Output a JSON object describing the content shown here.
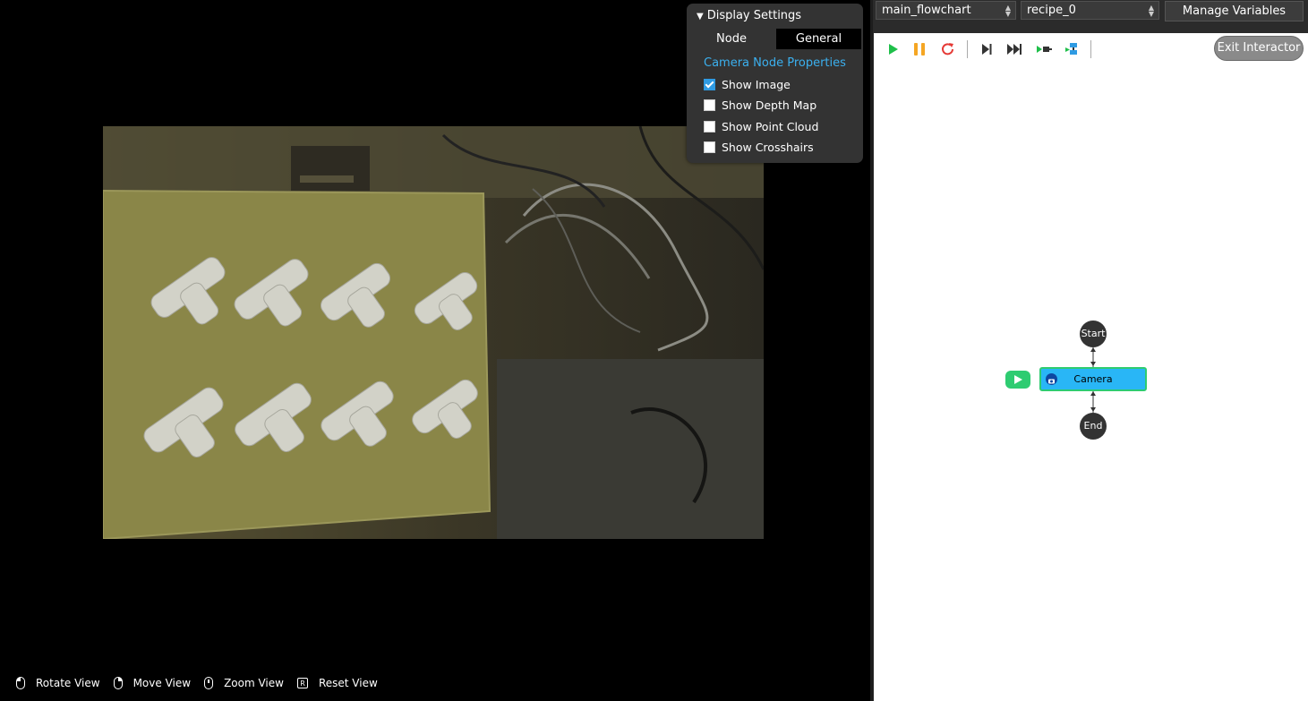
{
  "display_settings": {
    "title": "Display Settings",
    "tabs": {
      "node": "Node",
      "general": "General"
    },
    "section_title": "Camera Node Properties",
    "options": [
      {
        "label": "Show Image",
        "checked": true
      },
      {
        "label": "Show Depth Map",
        "checked": false
      },
      {
        "label": "Show Point Cloud",
        "checked": false
      },
      {
        "label": "Show Crosshairs",
        "checked": false
      }
    ]
  },
  "view_hints": {
    "rotate": "Rotate View",
    "move": "Move View",
    "zoom": "Zoom View",
    "reset_key": "R",
    "reset": "Reset View"
  },
  "top_bar": {
    "flowchart_select": "main_flowchart",
    "recipe_select": "recipe_0",
    "manage_variables": "Manage Variables"
  },
  "flowchart": {
    "exit_button": "Exit Interactor",
    "start": "Start",
    "camera": "Camera",
    "end": "End"
  },
  "colors": {
    "play": "#1fbf4a",
    "pause": "#f5a623",
    "reset": "#e53935",
    "node_fill": "#29b6f6",
    "node_border": "#2ecc71",
    "accent": "#3bb0ef"
  },
  "icons": [
    "play-icon",
    "pause-icon",
    "restart-icon",
    "step-icon",
    "step-all-icon",
    "step-into-icon",
    "step-out-icon",
    "camera-icon",
    "mouse-icon"
  ]
}
